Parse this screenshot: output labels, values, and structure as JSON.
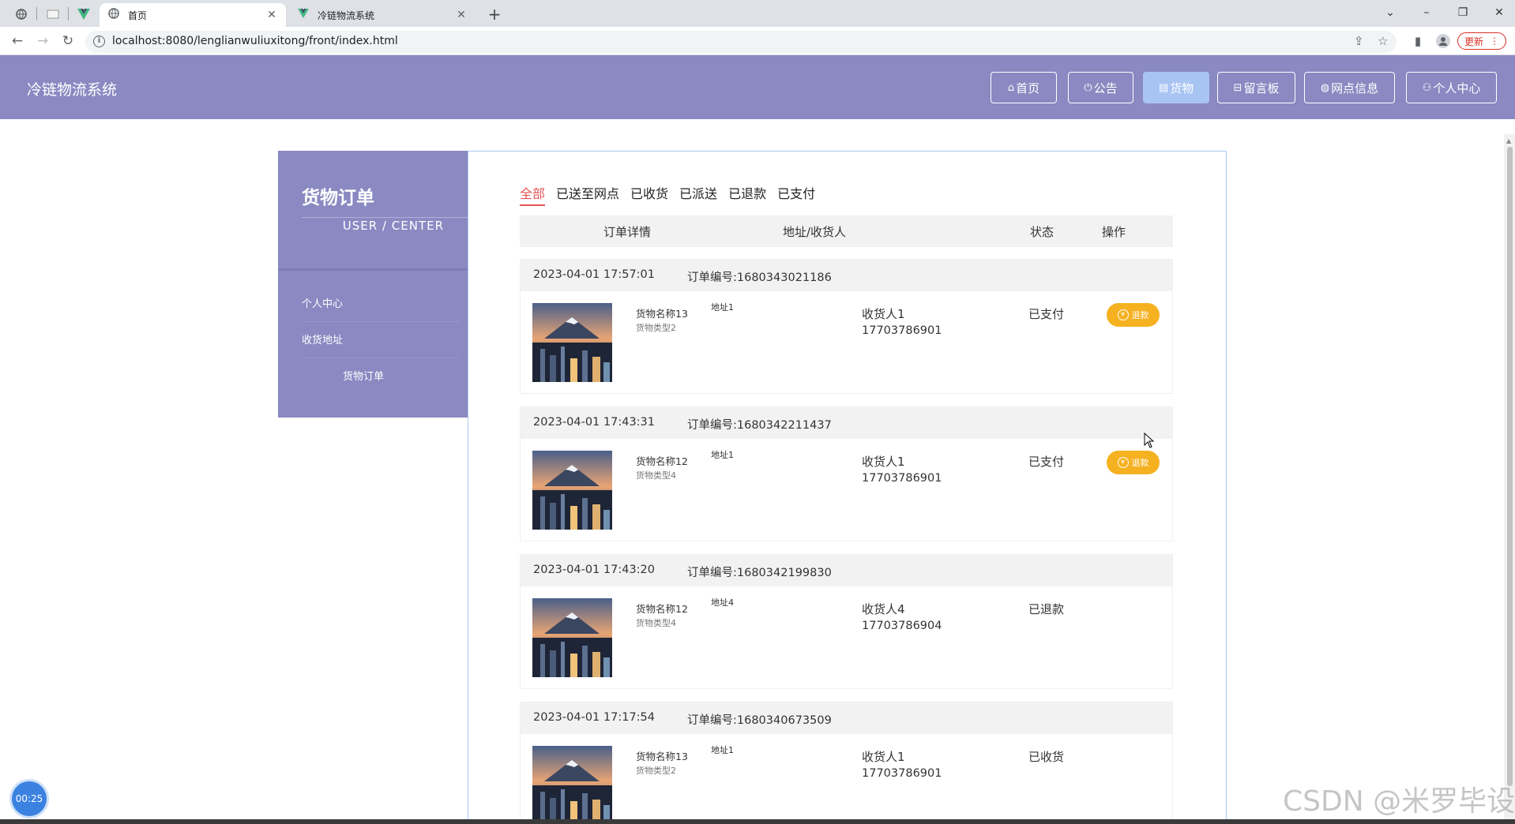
{
  "browser": {
    "pinned_tab_icons": [
      "globe-icon",
      "blank-page-icon",
      "vue-logo-icon"
    ],
    "tabs": [
      {
        "title": "首页",
        "icon": "globe-icon",
        "active": true
      },
      {
        "title": "冷链物流系统",
        "icon": "vue-logo-icon",
        "active": false
      }
    ],
    "new_tab_label": "+",
    "url": "localhost:8080/lenglianwuliuxitong/front/index.html",
    "update_label": "更新"
  },
  "site": {
    "title": "冷链物流系统",
    "nav": [
      {
        "label": "首页",
        "icon": "home-icon",
        "active": false
      },
      {
        "label": "公告",
        "icon": "power-icon",
        "active": false
      },
      {
        "label": "货物",
        "icon": "box-icon",
        "active": true
      },
      {
        "label": "留言板",
        "icon": "message-icon",
        "active": false
      },
      {
        "label": "网点信息",
        "icon": "globe-icon",
        "active": false
      },
      {
        "label": "个人中心",
        "icon": "user-icon",
        "active": false
      }
    ]
  },
  "sidebar": {
    "title": "货物订单",
    "subtitle": "USER / CENTER",
    "items": [
      {
        "label": "个人中心"
      },
      {
        "label": "收货地址"
      },
      {
        "label": "货物订单"
      }
    ]
  },
  "orders_page": {
    "filters": [
      "全部",
      "已送至网点",
      "已收货",
      "已派送",
      "已退款",
      "已支付"
    ],
    "active_filter": "全部",
    "columns": [
      "订单详情",
      "地址/收货人",
      "状态",
      "操作"
    ],
    "refund_label": "退款",
    "orders": [
      {
        "date": "2023-04-01 17:57:01",
        "number": "订单编号:1680343021186",
        "goods_name": "货物名称13",
        "goods_type": "货物类型2",
        "address": "地址1",
        "receiver": "收货人1",
        "phone": "17703786901",
        "status": "已支付",
        "refundable": true
      },
      {
        "date": "2023-04-01 17:43:31",
        "number": "订单编号:1680342211437",
        "goods_name": "货物名称12",
        "goods_type": "货物类型4",
        "address": "地址1",
        "receiver": "收货人1",
        "phone": "17703786901",
        "status": "已支付",
        "refundable": true
      },
      {
        "date": "2023-04-01 17:43:20",
        "number": "订单编号:1680342199830",
        "goods_name": "货物名称12",
        "goods_type": "货物类型4",
        "address": "地址4",
        "receiver": "收货人4",
        "phone": "17703786904",
        "status": "已退款",
        "refundable": false
      },
      {
        "date": "2023-04-01 17:17:54",
        "number": "订单编号:1680340673509",
        "goods_name": "货物名称13",
        "goods_type": "货物类型2",
        "address": "地址1",
        "receiver": "收货人1",
        "phone": "17703786901",
        "status": "已收货",
        "refundable": false
      }
    ]
  },
  "overlay": {
    "timer": "00:25",
    "watermark": "CSDN @米罗毕设"
  },
  "colors": {
    "header_purple": "#8a89c2",
    "active_nav": "#a8c4f3",
    "active_filter": "#e05555",
    "refund_button": "#f5b120"
  }
}
